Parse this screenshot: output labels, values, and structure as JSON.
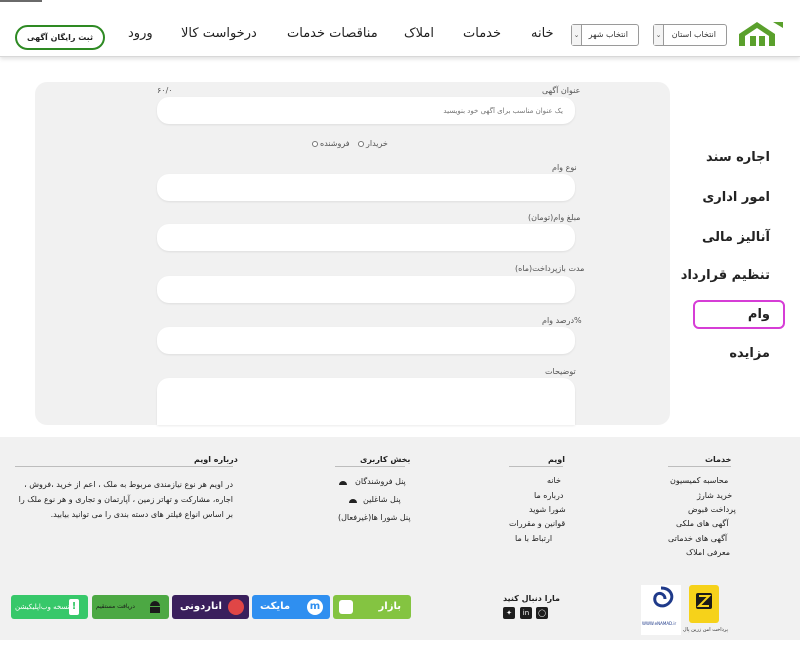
{
  "header": {
    "select_province": "انتخاب استان",
    "select_city": "انتخاب شهر",
    "nav": [
      "خانه",
      "خدمات",
      "املاک",
      "مناقصات خدمات",
      "درخواست کالا",
      "ورود"
    ],
    "cta": "ثبت رایگان آگهی"
  },
  "sidebar": {
    "items": [
      "اجاره سند",
      "امور اداری",
      "آنالیز مالی",
      "تنظیم قرارداد",
      "وام",
      "مزایده"
    ],
    "active": "وام"
  },
  "form": {
    "title_label": "عنوان آگهی",
    "title_counter": "۶۰/۰",
    "title_placeholder": "یک عنوان مناسب برای آگهی خود بنویسید",
    "radio_buyer": "خریدار",
    "radio_seller": "فروشنده",
    "loan_type_label": "نوع وام",
    "amount_label": "مبلغ وام(تومان)",
    "period_label": "مدت بازپرداخت(ماه)",
    "percent_label": "درصد وام%",
    "description_label": "توضیحات"
  },
  "footer": {
    "services_title": "خدمات",
    "services": [
      "محاسبه کمیسیون",
      "خرید شارژ",
      "پرداخت قبوض",
      "آگهی های ملکی",
      "آگهی های خدماتی",
      "معرفی املاک"
    ],
    "owim_title": "اویم",
    "owim_links": [
      "خانه",
      "درباره ما",
      "شورا شوید",
      "قوانین و مقررات",
      "ارتباط با ما"
    ],
    "user_title": "بخش کاربری",
    "user_links": [
      "پنل فروشندگان",
      "پنل شاغلین",
      "پنل شورا ها(غیرفعال)"
    ],
    "about_title": "درباره اویم",
    "about_text": "در اویم هر نوع نیازمندی مربوط به ملک ، اعم از خرید ،فروش ، اجاره، مشارکت و تهاتر زمین ، آپارتمان و تجاری و هر نوع ملک را بر اساس انواع فیلتر های دسته بندی را می توانید بیابید.",
    "follow_title": "مارا دنبال کنید",
    "badges": {
      "pwa": "نسخه وب‌اپلیکیشن",
      "direct": "دریافت مستقیم",
      "anardoni": "اناردونی",
      "myket": "مایکت",
      "bazaar": "بازار"
    },
    "zarinpal_caption": "پرداخت امن زرین پال",
    "enamad_caption": "WWW.eNAMAD.ir"
  }
}
